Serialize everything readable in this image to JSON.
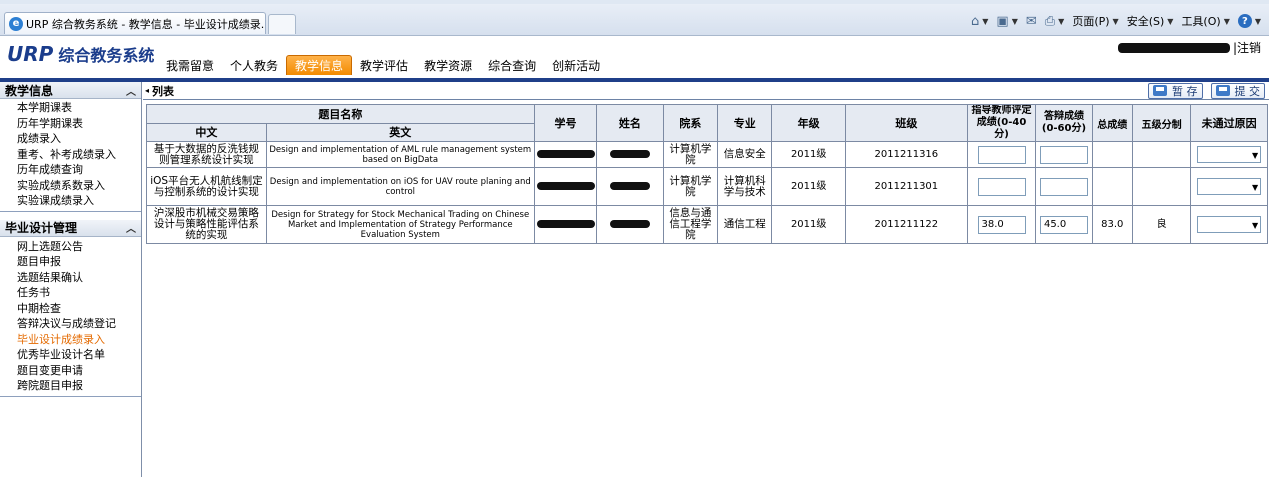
{
  "browser": {
    "tab_title": "URP 综合教务系统 - 教学信息 - 毕业设计成绩录...",
    "commands": [
      "页面(P)",
      "安全(S)",
      "工具(O)"
    ]
  },
  "header": {
    "logo_mark": "URP",
    "logo_name": "综合教务系统",
    "user_suffix": "|注销",
    "nav": [
      {
        "label": "我需留意"
      },
      {
        "label": "个人教务"
      },
      {
        "label": "教学信息",
        "active": true
      },
      {
        "label": "教学评估"
      },
      {
        "label": "教学资源"
      },
      {
        "label": "综合查询"
      },
      {
        "label": "创新活动"
      }
    ]
  },
  "sidebar": {
    "section1": {
      "title": "教学信息",
      "items": [
        "本学期课表",
        "历年学期课表",
        "成绩录入",
        "重考、补考成绩录入",
        "历年成绩查询",
        "实验成绩系数录入",
        "实验课成绩录入"
      ]
    },
    "section2": {
      "title": "毕业设计管理",
      "items": [
        "网上选题公告",
        "题目申报",
        "选题结果确认",
        "任务书",
        "中期检查",
        "答辩决议与成绩登记",
        "毕业设计成绩录入",
        "优秀毕业设计名单",
        "题目变更申请",
        "跨院题目申报"
      ],
      "active_index": 6
    }
  },
  "main": {
    "list_title": "列表",
    "save_label": "暂 存",
    "submit_label": "提 交",
    "table": {
      "headers": {
        "topic": "题目名称",
        "zh": "中文",
        "en": "英文",
        "student_id": "学号",
        "name": "姓名",
        "college": "院系",
        "major": "专业",
        "grade": "年级",
        "class": "班级",
        "advisor_score": "指导教师评定成绩(0-40分)",
        "defense_score": "答辩成绩(0-60分)",
        "total": "总成绩",
        "level": "五级分制",
        "fail_reason": "未通过原因"
      },
      "rows": [
        {
          "zh": "基于大数据的反洗钱规则管理系统设计实现",
          "en": "Design and implementation of AML rule management system based on BigData",
          "college": "计算机学院",
          "major": "信息安全",
          "grade": "2011级",
          "class": "2011211316",
          "advisor_score": "",
          "defense_score": "",
          "total": "",
          "level": "",
          "fail_reason": ""
        },
        {
          "zh": "iOS平台无人机航线制定与控制系统的设计实现",
          "en": "Design and implementation on iOS for UAV route planing and control",
          "college": "计算机学院",
          "major": "计算机科学与技术",
          "grade": "2011级",
          "class": "2011211301",
          "advisor_score": "",
          "defense_score": "",
          "total": "",
          "level": "",
          "fail_reason": ""
        },
        {
          "zh": "沪深股市机械交易策略设计与策略性能评估系统的实现",
          "en": "Design for Strategy for Stock Mechanical Trading on Chinese Market and Implementation of Strategy Performance Evaluation System",
          "college": "信息与通信工程学院",
          "major": "通信工程",
          "grade": "2011级",
          "class": "2011211122",
          "advisor_score": "38.0",
          "defense_score": "45.0",
          "total": "83.0",
          "level": "良",
          "fail_reason": ""
        }
      ]
    }
  },
  "colors": {
    "nav_active": "#f28a00",
    "nav_rule": "#1f3f89",
    "sidebar_active": "#e46a00",
    "logo": "#1b3d8c"
  }
}
